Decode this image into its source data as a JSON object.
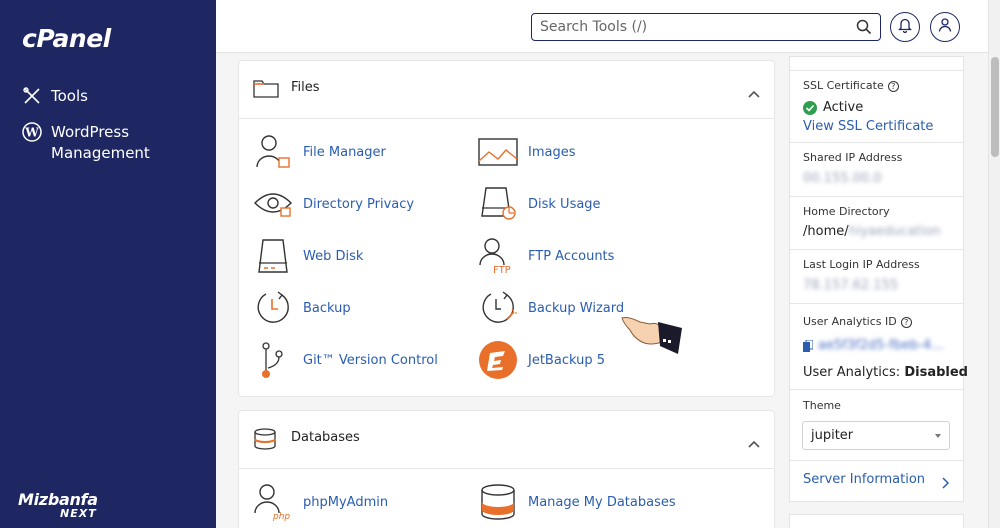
{
  "brand": "cPanel",
  "sidebar": {
    "items": [
      {
        "label": "Tools",
        "icon": "tools-icon"
      },
      {
        "label": "WordPress Management",
        "icon": "wordpress-icon"
      }
    ]
  },
  "footer_logo": {
    "line1": "Mizbanfa",
    "line2": "NEXT"
  },
  "search": {
    "placeholder": "Search Tools (/)"
  },
  "sections": {
    "files": {
      "title": "Files",
      "tools": [
        {
          "label": "File Manager",
          "icon": "file-manager-icon"
        },
        {
          "label": "Images",
          "icon": "images-icon"
        },
        {
          "label": "Directory Privacy",
          "icon": "directory-privacy-icon"
        },
        {
          "label": "Disk Usage",
          "icon": "disk-usage-icon"
        },
        {
          "label": "Web Disk",
          "icon": "web-disk-icon"
        },
        {
          "label": "FTP Accounts",
          "icon": "ftp-accounts-icon"
        },
        {
          "label": "Backup",
          "icon": "backup-icon"
        },
        {
          "label": "Backup Wizard",
          "icon": "backup-wizard-icon"
        },
        {
          "label": "Git™ Version Control",
          "icon": "git-icon"
        },
        {
          "label": "JetBackup 5",
          "icon": "jetbackup-icon"
        }
      ]
    },
    "databases": {
      "title": "Databases",
      "tools": [
        {
          "label": "phpMyAdmin",
          "icon": "phpmyadmin-icon"
        },
        {
          "label": "Manage My Databases",
          "icon": "manage-databases-icon"
        }
      ]
    }
  },
  "info": {
    "ssl_label": "SSL Certificate",
    "ssl_status": "Active",
    "ssl_link": "View SSL Certificate",
    "shared_ip_label": "Shared IP Address",
    "shared_ip_value": "00.155.00.0",
    "home_dir_label": "Home Directory",
    "home_dir_value": "/home/",
    "home_dir_user": "hiyaeducation",
    "last_login_label": "Last Login IP Address",
    "last_login_value": "78.157.62.155",
    "analytics_id_label": "User Analytics ID",
    "analytics_id_value": "ae5f3f2d5-fbeb-4...",
    "analytics_label": "User Analytics:",
    "analytics_value": "Disabled",
    "theme_label": "Theme",
    "theme_value": "jupiter",
    "server_info": "Server Information"
  },
  "colors": {
    "sidebar_bg": "#1e2761",
    "link": "#2a5db0",
    "accent_orange": "#e8702a",
    "active_green": "#2e9e4f"
  }
}
